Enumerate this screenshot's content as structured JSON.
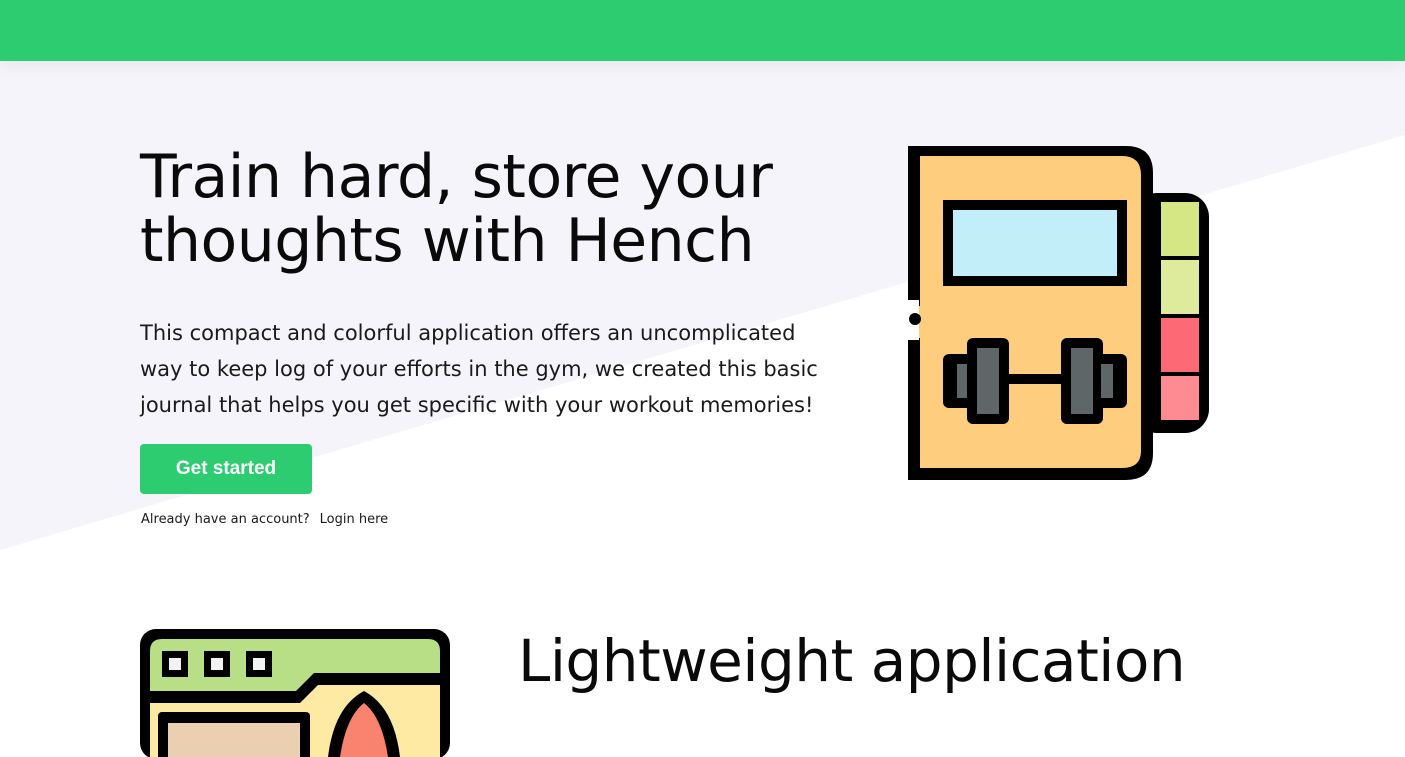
{
  "header": {
    "bar_color": "#2ecc71"
  },
  "hero": {
    "title": "Train hard, store your thoughts with Hench",
    "description": "This compact and colorful application offers an uncomplicated way to keep log of your efforts in the gym, we created this basic journal that helps you get specific with your workout memories!",
    "cta_label": "Get started",
    "account_prompt": "Already have an account?",
    "login_label": "Login here",
    "illustration_icon": "dumbbell-journal-icon"
  },
  "features": {
    "title": "Lightweight application",
    "illustration_icon": "browser-window-icon"
  },
  "colors": {
    "accent": "#2ecc71",
    "hero_background": "#f5f4fa"
  }
}
